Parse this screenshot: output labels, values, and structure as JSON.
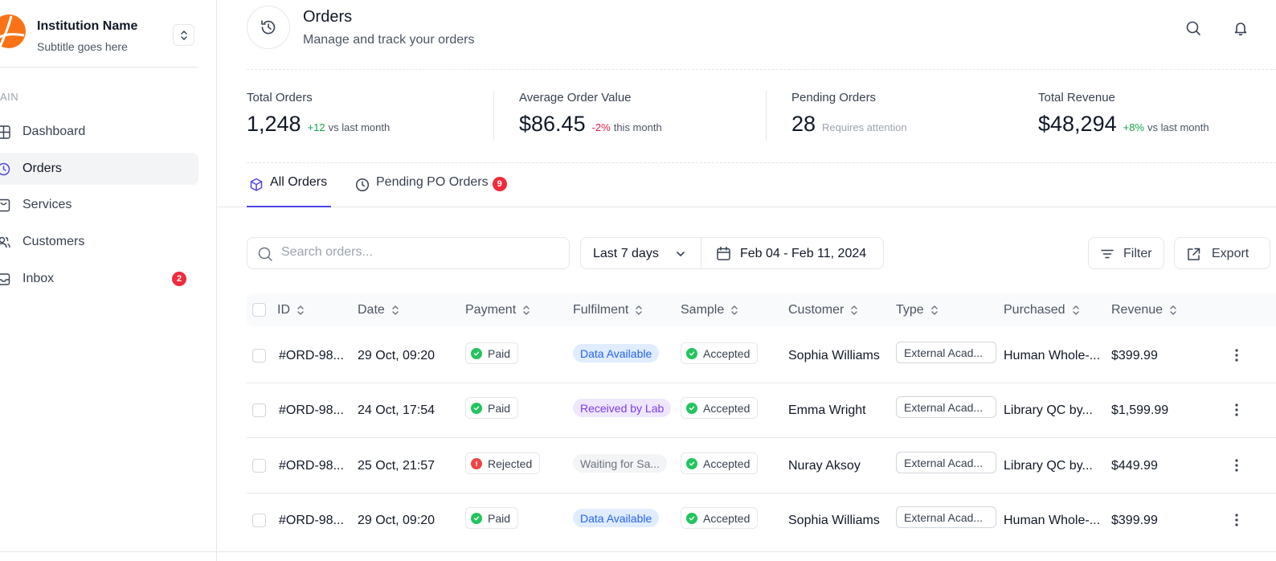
{
  "sidebar": {
    "institution_name": "Institution Name",
    "institution_subtitle": "Subtitle goes here",
    "section_label": "AIN",
    "items": [
      {
        "label": "Dashboard",
        "icon": "grid-icon"
      },
      {
        "label": "Orders",
        "icon": "history-icon",
        "active": true
      },
      {
        "label": "Services",
        "icon": "bag-icon"
      },
      {
        "label": "Customers",
        "icon": "users-icon"
      },
      {
        "label": "Inbox",
        "icon": "inbox-icon",
        "badge": "2"
      }
    ]
  },
  "header": {
    "title": "Orders",
    "subtitle": "Manage and track your orders"
  },
  "stats": [
    {
      "label": "Total Orders",
      "value": "1,248",
      "change": "+12",
      "note": "vs last month"
    },
    {
      "label": "Average Order Value",
      "value": "$86.45",
      "change": "-2%",
      "note": "this month"
    },
    {
      "label": "Pending Orders",
      "value": "28",
      "note": "Requires attention"
    },
    {
      "label": "Total Revenue",
      "value": "$48,294",
      "change": "+8%",
      "note": "vs last month"
    }
  ],
  "tabs": [
    {
      "label": "All Orders",
      "active": true
    },
    {
      "label": "Pending PO Orders",
      "badge": "9"
    }
  ],
  "toolbar": {
    "search_placeholder": "Search orders...",
    "range_label": "Last 7 days",
    "date_range": "Feb 04 - Feb 11, 2024",
    "filter_label": "Filter",
    "export_label": "Export"
  },
  "table": {
    "columns": [
      "ID",
      "Date",
      "Payment",
      "Fulfilment",
      "Sample",
      "Customer",
      "Type",
      "Purchased",
      "Revenue"
    ],
    "rows": [
      {
        "id": "#ORD-98...",
        "date": "29 Oct, 09:20",
        "payment": "Paid",
        "fulfilment": "Data Available",
        "sample": "Accepted",
        "customer": "Sophia Williams",
        "type": "External Acad...",
        "purchased": "Human Whole-...",
        "revenue": "$399.99"
      },
      {
        "id": "#ORD-98...",
        "date": "24 Oct, 17:54",
        "payment": "Paid",
        "fulfilment": "Received by Lab",
        "sample": "Accepted",
        "customer": "Emma Wright",
        "type": "External Acad...",
        "purchased": "Library QC by...",
        "revenue": "$1,599.99"
      },
      {
        "id": "#ORD-98...",
        "date": "25 Oct, 21:57",
        "payment": "Rejected",
        "fulfilment": "Waiting for Sa...",
        "sample": "Accepted",
        "customer": "Nuray Aksoy",
        "type": "External Acad...",
        "purchased": "Library QC by...",
        "revenue": "$449.99"
      },
      {
        "id": "#ORD-98...",
        "date": "29 Oct, 09:20",
        "payment": "Paid",
        "fulfilment": "Data Available",
        "sample": "Accepted",
        "customer": "Sophia Williams",
        "type": "External Acad...",
        "purchased": "Human Whole-...",
        "revenue": "$399.99"
      }
    ]
  },
  "colors": {
    "accent": "#4f46e5",
    "badge_red": "#ef2b3c",
    "paid_green": "#22c55e",
    "rejected_red": "#ef4444",
    "brand_orange": "#f97316"
  }
}
